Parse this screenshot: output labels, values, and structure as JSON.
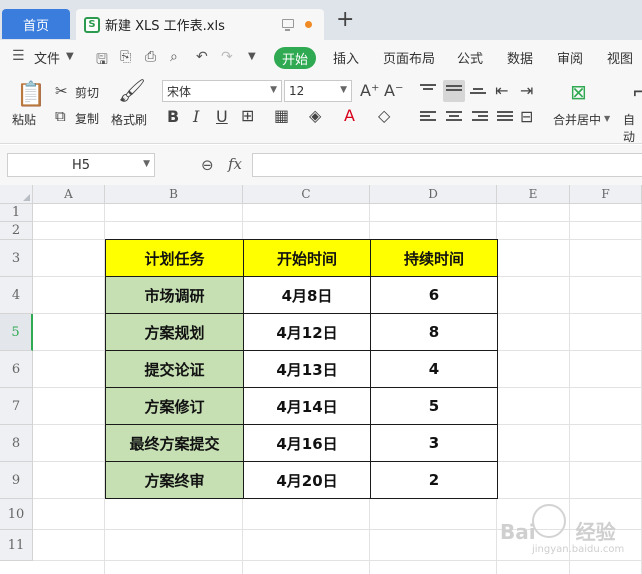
{
  "tabs": {
    "home_label": "首页",
    "doc_icon": "S",
    "doc_label": "新建 XLS 工作表.xls",
    "new_tab": "+"
  },
  "menu": {
    "file_label": "文件",
    "items": [
      "开始",
      "插入",
      "页面布局",
      "公式",
      "数据",
      "审阅",
      "视图"
    ]
  },
  "ribbon": {
    "paste_label": "粘贴",
    "cut_label": "剪切",
    "copy_label": "复制",
    "format_painter_label": "格式刷",
    "font_name": "宋体",
    "font_size": "12",
    "merge_label": "合并居中",
    "auto_label": "自动"
  },
  "formula_bar": {
    "cell_ref": "H5",
    "fx": "fx",
    "value": ""
  },
  "grid": {
    "columns": [
      "A",
      "B",
      "C",
      "D",
      "E",
      "F"
    ],
    "rows": [
      "1",
      "2",
      "3",
      "4",
      "5",
      "6",
      "7",
      "8",
      "9",
      "10",
      "11"
    ],
    "active_row": "5"
  },
  "table": {
    "headers": [
      "计划任务",
      "开始时间",
      "持续时间"
    ],
    "rows": [
      [
        "市场调研",
        "4月8日",
        "6"
      ],
      [
        "方案规划",
        "4月12日",
        "8"
      ],
      [
        "提交论证",
        "4月13日",
        "4"
      ],
      [
        "方案修订",
        "4月14日",
        "5"
      ],
      [
        "最终方案提交",
        "4月16日",
        "3"
      ],
      [
        "方案终审",
        "4月20日",
        "2"
      ]
    ],
    "colors": {
      "header_bg": "#ffff00",
      "task_bg": "#c6e0b4"
    }
  },
  "watermark": {
    "brand": "Bai",
    "suffix": "经验",
    "sub": "jingyan.baidu.com"
  }
}
